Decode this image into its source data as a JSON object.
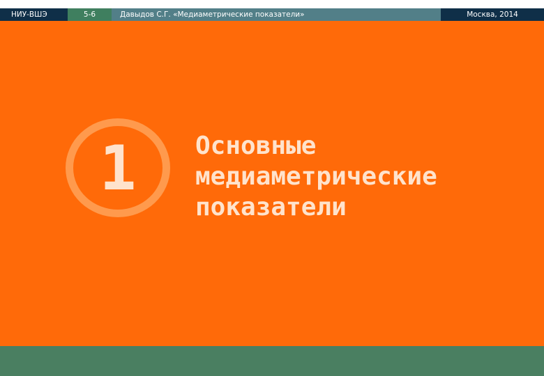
{
  "header": {
    "org": "НИУ-ВШЭ",
    "slide": "5-6",
    "title": "Давыдов С.Г. «Медиаметрические показатели»",
    "place_date": "Москва, 2014"
  },
  "section": {
    "number": "1",
    "title_lines": [
      "Основные",
      "медиаметрические",
      "показатели"
    ]
  },
  "colors": {
    "background": "#ff6a09",
    "ring": "#ff9a4d",
    "text_light": "#ffe3cc",
    "header_dark": "#0f2f48",
    "header_green": "#3f7f5f",
    "header_teal": "#527f88",
    "footer": "#4a7f61"
  }
}
